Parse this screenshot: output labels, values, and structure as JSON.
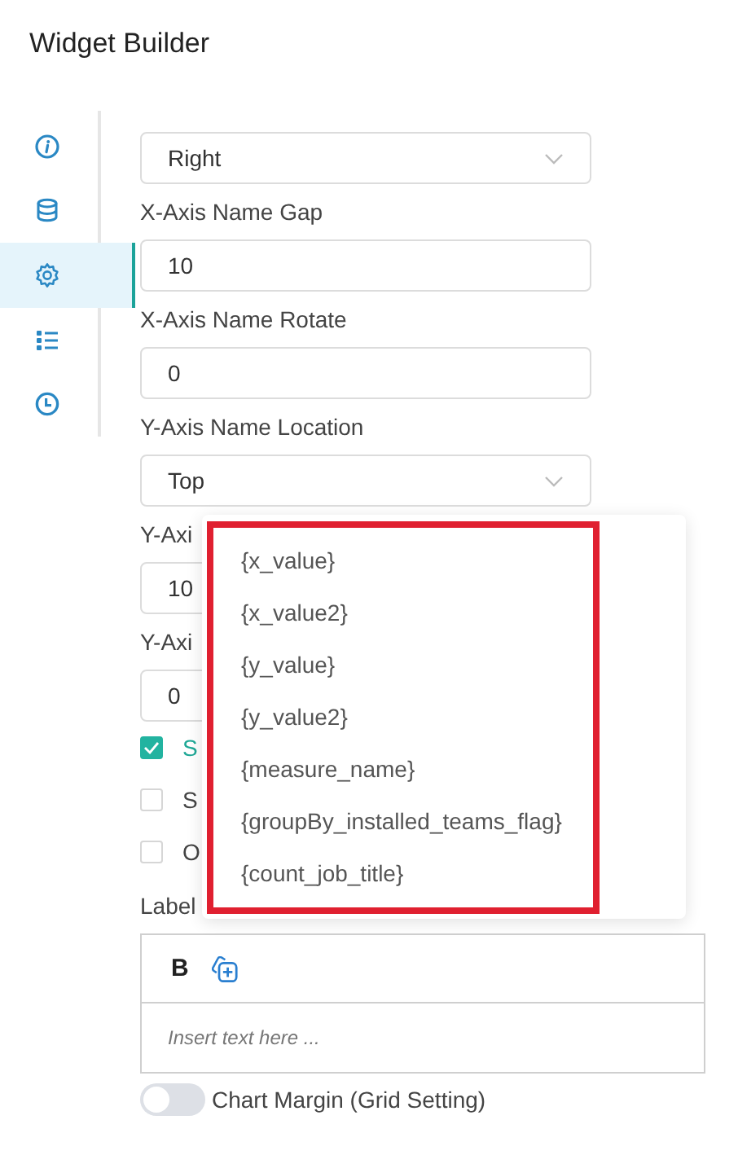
{
  "window": {
    "title": "Widget Builder"
  },
  "sidebar": {
    "items": [
      {
        "kind": "info",
        "selected": false
      },
      {
        "kind": "database",
        "selected": false
      },
      {
        "kind": "settings",
        "selected": true
      },
      {
        "kind": "list",
        "selected": false
      },
      {
        "kind": "history",
        "selected": false
      }
    ]
  },
  "form": {
    "rows": [
      {
        "kind": "select",
        "value": "Right"
      },
      {
        "kind": "label",
        "text": "X-Axis Name Gap"
      },
      {
        "kind": "input",
        "value": "10"
      },
      {
        "kind": "label",
        "text": "X-Axis Name Rotate"
      },
      {
        "kind": "input",
        "value": "0"
      },
      {
        "kind": "label",
        "text": "Y-Axis Name Location"
      },
      {
        "kind": "select",
        "value": "Top"
      },
      {
        "kind": "label",
        "text": "Y-Axi"
      },
      {
        "kind": "input",
        "value": "10"
      },
      {
        "kind": "label",
        "text": "Y-Axi"
      },
      {
        "kind": "input",
        "value": "0"
      },
      {
        "kind": "checkbox",
        "label": "S",
        "checked": true
      },
      {
        "kind": "checkbox",
        "label": "S",
        "checked": false
      },
      {
        "kind": "checkbox",
        "label": "O",
        "checked": false
      },
      {
        "kind": "label",
        "text": "Label"
      },
      {
        "kind": "editor",
        "toolbar": [
          {
            "kind": "bold",
            "label": "B"
          },
          {
            "kind": "insert-variable"
          }
        ],
        "placeholder": "Insert text here ..."
      },
      {
        "kind": "toggle",
        "on": false,
        "label": "Chart Margin (Grid Setting)"
      }
    ]
  },
  "variable_menu": {
    "highlighted": true,
    "items": [
      "{x_value}",
      "{x_value2}",
      "{y_value}",
      "{y_value2}",
      "{measure_name}",
      "{groupBy_installed_teams_flag}",
      "{count_job_title}"
    ]
  }
}
